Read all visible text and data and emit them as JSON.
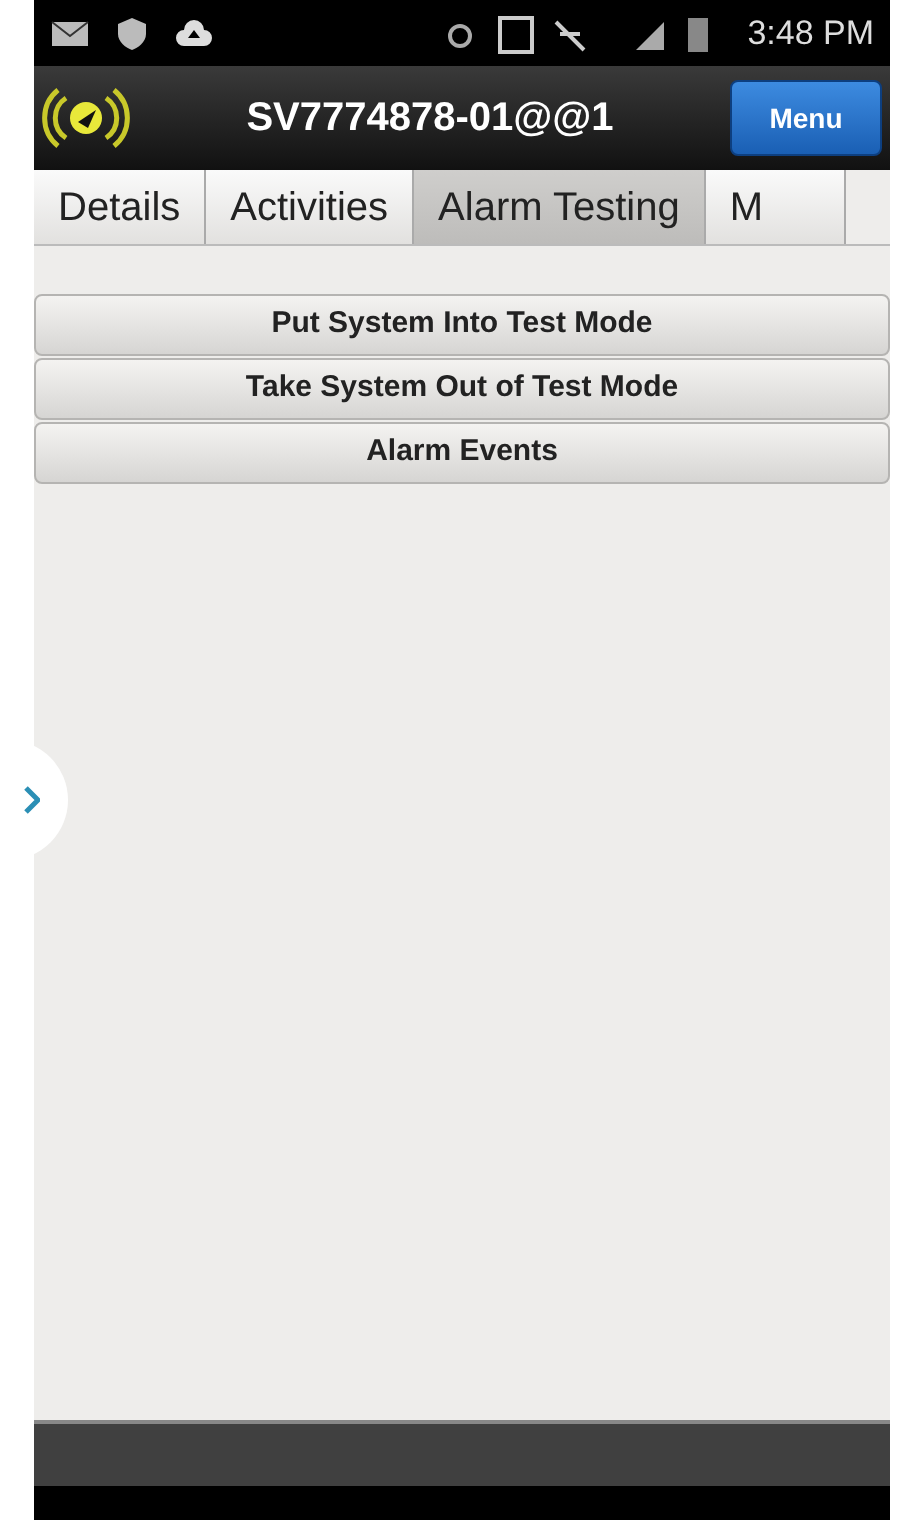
{
  "status_bar": {
    "time": "3:48 PM"
  },
  "header": {
    "title": "SV7774878-01@@1",
    "menu_button": "Menu"
  },
  "tabs": [
    {
      "label": "Details",
      "selected": false
    },
    {
      "label": "Activities",
      "selected": false
    },
    {
      "label": "Alarm Testing",
      "selected": true
    },
    {
      "label": "M",
      "selected": false
    }
  ],
  "actions": [
    "Put System Into Test Mode",
    "Take System Out of Test Mode",
    "Alarm Events"
  ]
}
